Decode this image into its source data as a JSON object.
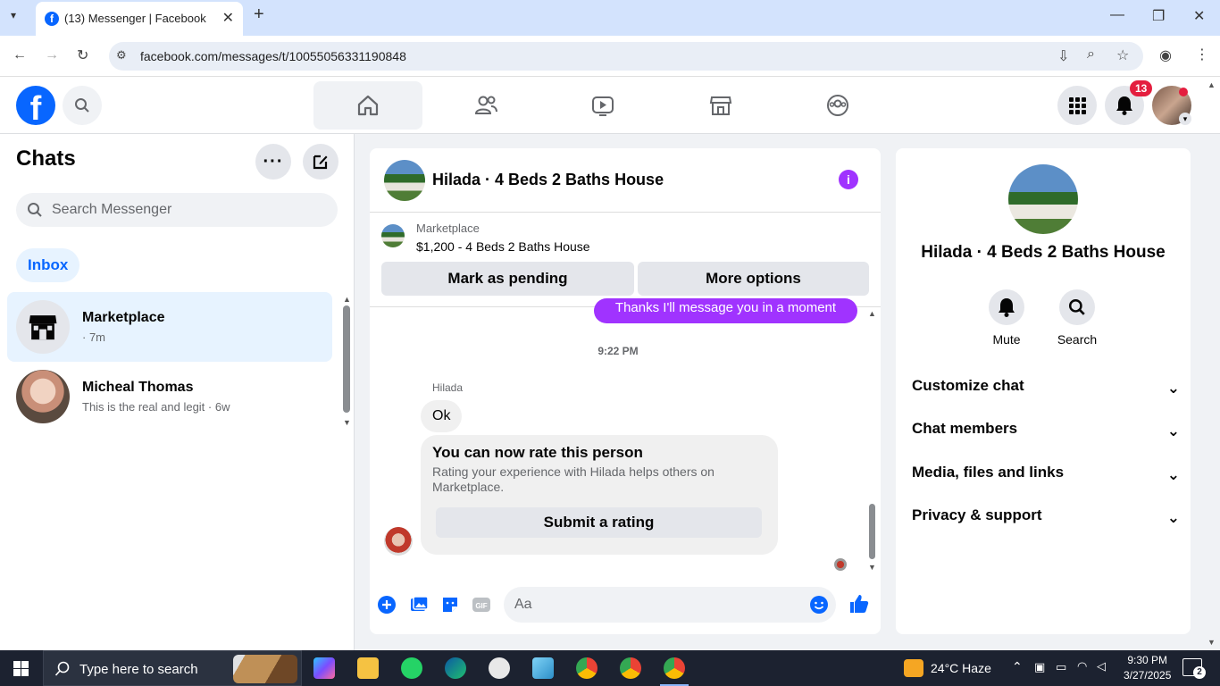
{
  "browser": {
    "tab_title": "(13) Messenger | Facebook",
    "url": "facebook.com/messages/t/10055056331190848"
  },
  "fb_nav": {
    "notification_count": "13"
  },
  "left_panel": {
    "title": "Chats",
    "search_placeholder": "Search Messenger",
    "filter_label": "Inbox",
    "chats": [
      {
        "name": "Marketplace",
        "subtitle": "· 7m"
      },
      {
        "name": "Micheal Thomas",
        "subtitle": "This is the real and legit · 6w"
      }
    ]
  },
  "conversation": {
    "title": "Hilada · 4 Beds 2 Baths House",
    "marketplace_label": "Marketplace",
    "listing": "$1,200 - 4 Beds 2 Baths House",
    "mark_pending": "Mark as pending",
    "more_options": "More options",
    "partial_message": "Thanks I'll message you in a moment",
    "timestamp": "9:22 PM",
    "sender_name": "Hilada",
    "ok_message": "Ok",
    "rate_title": "You can now rate this person",
    "rate_desc": "Rating your experience with Hilada helps others on Marketplace.",
    "rate_button": "Submit a rating",
    "input_placeholder": "Aa"
  },
  "right_panel": {
    "name": "Hilada · 4 Beds 2 Baths House",
    "mute": "Mute",
    "search": "Search",
    "rows": [
      "Customize chat",
      "Chat members",
      "Media, files and links",
      "Privacy & support"
    ]
  },
  "taskbar": {
    "search_placeholder": "Type here to search",
    "weather": "24°C  Haze",
    "time": "9:30 PM",
    "date": "3/27/2025",
    "notif_count": "2"
  },
  "colors": {
    "fb_blue": "#0866ff",
    "messenger_purple": "#a033ff",
    "badge_red": "#e41e3f"
  }
}
